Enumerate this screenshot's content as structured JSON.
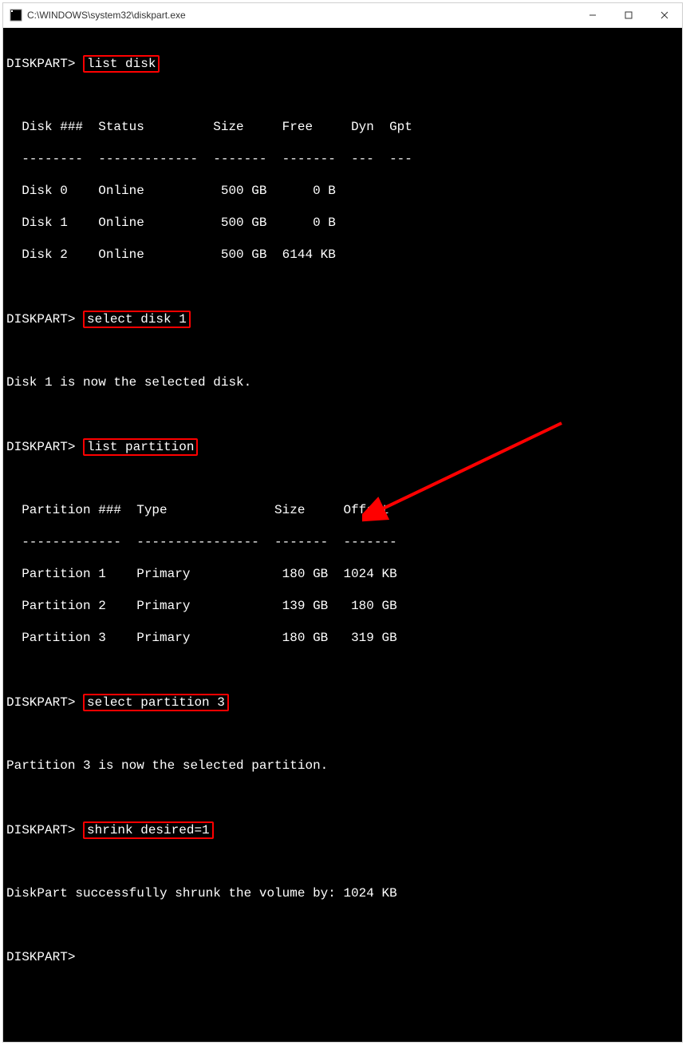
{
  "titlebar": {
    "path": "C:\\WINDOWS\\system32\\diskpart.exe"
  },
  "prompts": {
    "p1": "DISKPART> ",
    "p2": "DISKPART> ",
    "p3": "DISKPART> ",
    "p4": "DISKPART> ",
    "p5": "DISKPART> ",
    "p6": "DISKPART>"
  },
  "commands": {
    "cmd1": "list disk",
    "cmd2": "select disk 1",
    "cmd3": "list partition",
    "cmd4": "select partition 3",
    "cmd5": "shrink desired=1"
  },
  "disk_table": {
    "header": "  Disk ###  Status         Size     Free     Dyn  Gpt",
    "divider": "  --------  -------------  -------  -------  ---  ---",
    "rows": [
      "  Disk 0    Online          500 GB      0 B",
      "  Disk 1    Online          500 GB      0 B",
      "  Disk 2    Online          500 GB  6144 KB"
    ]
  },
  "partition_table": {
    "header": "  Partition ###  Type              Size     Offset",
    "divider": "  -------------  ----------------  -------  -------",
    "rows": [
      "  Partition 1    Primary            180 GB  1024 KB",
      "  Partition 2    Primary            139 GB   180 GB",
      "  Partition 3    Primary            180 GB   319 GB"
    ]
  },
  "messages": {
    "disk_selected": "Disk 1 is now the selected disk.",
    "partition_selected": "Partition 3 is now the selected partition.",
    "shrink_success": "DiskPart successfully shrunk the volume by: 1024 KB"
  },
  "annotation": {
    "highlight_color": "#ff0000",
    "arrow_points_to": "1024 KB"
  }
}
